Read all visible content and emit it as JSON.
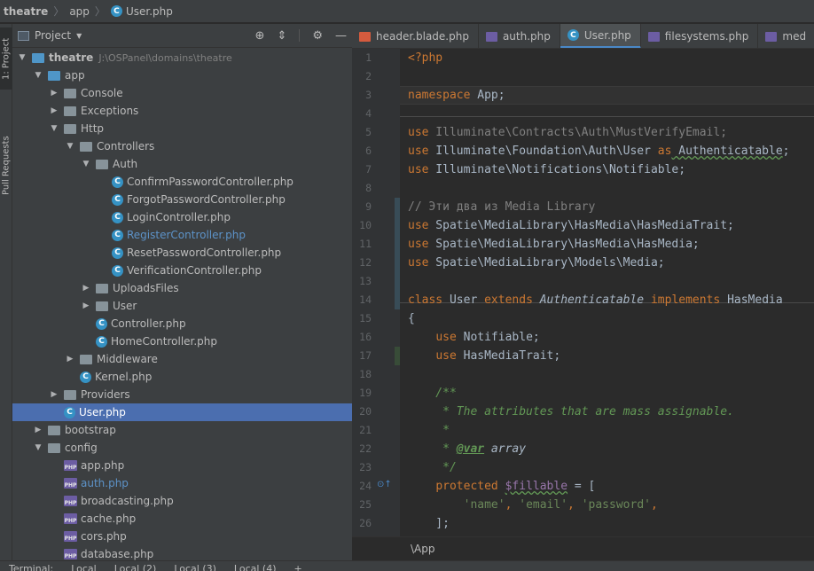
{
  "breadcrumbs": [
    "theatre",
    "app",
    "User.php"
  ],
  "left_strip": {
    "project_tab": "1: Project",
    "pull_tab": "Pull Requests"
  },
  "project_panel": {
    "title": "Project",
    "root_path": "J:\\OSPanel\\domains\\theatre",
    "tree": [
      {
        "label": "theatre",
        "depth": 0,
        "kind": "folder-blue",
        "expanded": true,
        "bold": true
      },
      {
        "label": "app",
        "depth": 1,
        "kind": "folder-blue",
        "expanded": true
      },
      {
        "label": "Console",
        "depth": 2,
        "kind": "folder",
        "expanded": false
      },
      {
        "label": "Exceptions",
        "depth": 2,
        "kind": "folder",
        "expanded": false
      },
      {
        "label": "Http",
        "depth": 2,
        "kind": "folder",
        "expanded": true
      },
      {
        "label": "Controllers",
        "depth": 3,
        "kind": "folder",
        "expanded": true
      },
      {
        "label": "Auth",
        "depth": 4,
        "kind": "folder",
        "expanded": true
      },
      {
        "label": "ConfirmPasswordController.php",
        "depth": 5,
        "kind": "class"
      },
      {
        "label": "ForgotPasswordController.php",
        "depth": 5,
        "kind": "class"
      },
      {
        "label": "LoginController.php",
        "depth": 5,
        "kind": "class"
      },
      {
        "label": "RegisterController.php",
        "depth": 5,
        "kind": "class",
        "modified": true
      },
      {
        "label": "ResetPasswordController.php",
        "depth": 5,
        "kind": "class"
      },
      {
        "label": "VerificationController.php",
        "depth": 5,
        "kind": "class"
      },
      {
        "label": "UploadsFiles",
        "depth": 4,
        "kind": "folder",
        "expanded": false
      },
      {
        "label": "User",
        "depth": 4,
        "kind": "folder",
        "expanded": false
      },
      {
        "label": "Controller.php",
        "depth": 4,
        "kind": "class"
      },
      {
        "label": "HomeController.php",
        "depth": 4,
        "kind": "class"
      },
      {
        "label": "Middleware",
        "depth": 3,
        "kind": "folder",
        "expanded": false
      },
      {
        "label": "Kernel.php",
        "depth": 3,
        "kind": "class"
      },
      {
        "label": "Providers",
        "depth": 2,
        "kind": "folder",
        "expanded": false
      },
      {
        "label": "User.php",
        "depth": 2,
        "kind": "class",
        "selected": true
      },
      {
        "label": "bootstrap",
        "depth": 1,
        "kind": "folder",
        "expanded": false
      },
      {
        "label": "config",
        "depth": 1,
        "kind": "folder",
        "expanded": true
      },
      {
        "label": "app.php",
        "depth": 2,
        "kind": "php"
      },
      {
        "label": "auth.php",
        "depth": 2,
        "kind": "php",
        "modified": true
      },
      {
        "label": "broadcasting.php",
        "depth": 2,
        "kind": "php"
      },
      {
        "label": "cache.php",
        "depth": 2,
        "kind": "php"
      },
      {
        "label": "cors.php",
        "depth": 2,
        "kind": "php"
      },
      {
        "label": "database.php",
        "depth": 2,
        "kind": "php"
      }
    ]
  },
  "editor_tabs": [
    {
      "label": "header.blade.php",
      "icon": "blade-icon"
    },
    {
      "label": "auth.php",
      "icon": "php-file-icon"
    },
    {
      "label": "User.php",
      "icon": "class-icon",
      "active": true
    },
    {
      "label": "filesystems.php",
      "icon": "php-file-icon"
    },
    {
      "label": "med",
      "icon": "php-file-icon"
    }
  ],
  "code_lines": [
    {
      "n": "1",
      "parts": [
        {
          "t": "<?php",
          "c": "kw"
        }
      ]
    },
    {
      "n": "2",
      "parts": []
    },
    {
      "n": "3",
      "parts": [
        {
          "t": "namespace",
          "c": "kw"
        },
        {
          "t": " App;",
          "c": "tx"
        }
      ]
    },
    {
      "n": "4",
      "parts": []
    },
    {
      "n": "5",
      "parts": [
        {
          "t": "use",
          "c": "kw"
        },
        {
          "t": " Illuminate\\Contracts\\Auth\\MustVerifyEmail;",
          "c": "dim"
        }
      ]
    },
    {
      "n": "6",
      "parts": [
        {
          "t": "use",
          "c": "kw"
        },
        {
          "t": " Illuminate\\Foundation\\Auth\\User ",
          "c": "tx"
        },
        {
          "t": "as",
          "c": "kw"
        },
        {
          "t": " Authenticatable",
          "c": "tx wavy"
        },
        {
          "t": ";",
          "c": "tx"
        }
      ]
    },
    {
      "n": "7",
      "parts": [
        {
          "t": "use",
          "c": "kw"
        },
        {
          "t": " Illuminate\\Notifications\\Notifiable;",
          "c": "tx"
        }
      ]
    },
    {
      "n": "8",
      "parts": []
    },
    {
      "n": "9",
      "parts": [
        {
          "t": "// Эти два из Media Library",
          "c": "cm"
        }
      ]
    },
    {
      "n": "10",
      "parts": [
        {
          "t": "use",
          "c": "kw"
        },
        {
          "t": " Spatie\\MediaLibrary\\HasMedia\\HasMediaTrait;",
          "c": "tx"
        }
      ]
    },
    {
      "n": "11",
      "parts": [
        {
          "t": "use",
          "c": "kw"
        },
        {
          "t": " Spatie\\MediaLibrary\\HasMedia\\HasMedia;",
          "c": "tx"
        }
      ]
    },
    {
      "n": "12",
      "parts": [
        {
          "t": "use",
          "c": "kw"
        },
        {
          "t": " Spatie\\MediaLibrary\\Models\\Media;",
          "c": "tx"
        }
      ]
    },
    {
      "n": "13",
      "parts": []
    },
    {
      "n": "14",
      "parts": [
        {
          "t": "class",
          "c": "kw"
        },
        {
          "t": " User ",
          "c": "tx"
        },
        {
          "t": "extends",
          "c": "kw"
        },
        {
          "t": " ",
          "c": "tx"
        },
        {
          "t": "Authenticatable",
          "c": "ital"
        },
        {
          "t": " ",
          "c": "tx"
        },
        {
          "t": "implements",
          "c": "kw"
        },
        {
          "t": " HasMedia",
          "c": "tx"
        }
      ]
    },
    {
      "n": "15",
      "parts": [
        {
          "t": "{",
          "c": "tx"
        }
      ]
    },
    {
      "n": "16",
      "parts": [
        {
          "t": "    ",
          "c": "tx"
        },
        {
          "t": "use",
          "c": "kw"
        },
        {
          "t": " Notifiable;",
          "c": "tx"
        }
      ]
    },
    {
      "n": "17",
      "parts": [
        {
          "t": "    ",
          "c": "tx"
        },
        {
          "t": "use",
          "c": "kw"
        },
        {
          "t": " HasMediaTrait;",
          "c": "tx"
        }
      ]
    },
    {
      "n": "18",
      "parts": []
    },
    {
      "n": "19",
      "parts": [
        {
          "t": "    /**",
          "c": "doc"
        }
      ]
    },
    {
      "n": "20",
      "parts": [
        {
          "t": "     * The attributes that are mass assignable.",
          "c": "doc"
        }
      ]
    },
    {
      "n": "21",
      "parts": [
        {
          "t": "     *",
          "c": "doc"
        }
      ]
    },
    {
      "n": "22",
      "parts": [
        {
          "t": "     * ",
          "c": "doc"
        },
        {
          "t": "@var",
          "c": "doctag"
        },
        {
          "t": " array",
          "c": "ital"
        }
      ]
    },
    {
      "n": "23",
      "parts": [
        {
          "t": "     */",
          "c": "doc"
        }
      ]
    },
    {
      "n": "24",
      "parts": [
        {
          "t": "    ",
          "c": "tx"
        },
        {
          "t": "protected",
          "c": "kw"
        },
        {
          "t": " ",
          "c": "tx"
        },
        {
          "t": "$fillable",
          "c": "var wavy"
        },
        {
          "t": " = [",
          "c": "tx"
        }
      ]
    },
    {
      "n": "25",
      "parts": [
        {
          "t": "        ",
          "c": "tx"
        },
        {
          "t": "'name'",
          "c": "str"
        },
        {
          "t": ", ",
          "c": "kw"
        },
        {
          "t": "'email'",
          "c": "str"
        },
        {
          "t": ", ",
          "c": "kw"
        },
        {
          "t": "'password'",
          "c": "str"
        },
        {
          "t": ",",
          "c": "kw"
        }
      ]
    },
    {
      "n": "26",
      "parts": [
        {
          "t": "    ];",
          "c": "tx"
        }
      ]
    }
  ],
  "editor_breadcrumb": "\\App",
  "bottom_tabs": [
    "Terminal:",
    "Local",
    "Local (2)",
    "Local (3)",
    "Local (4)",
    "+"
  ],
  "colors": {
    "selection": "#4b6eaf",
    "accent": "#4a88c7",
    "keyword": "#cc7832"
  }
}
